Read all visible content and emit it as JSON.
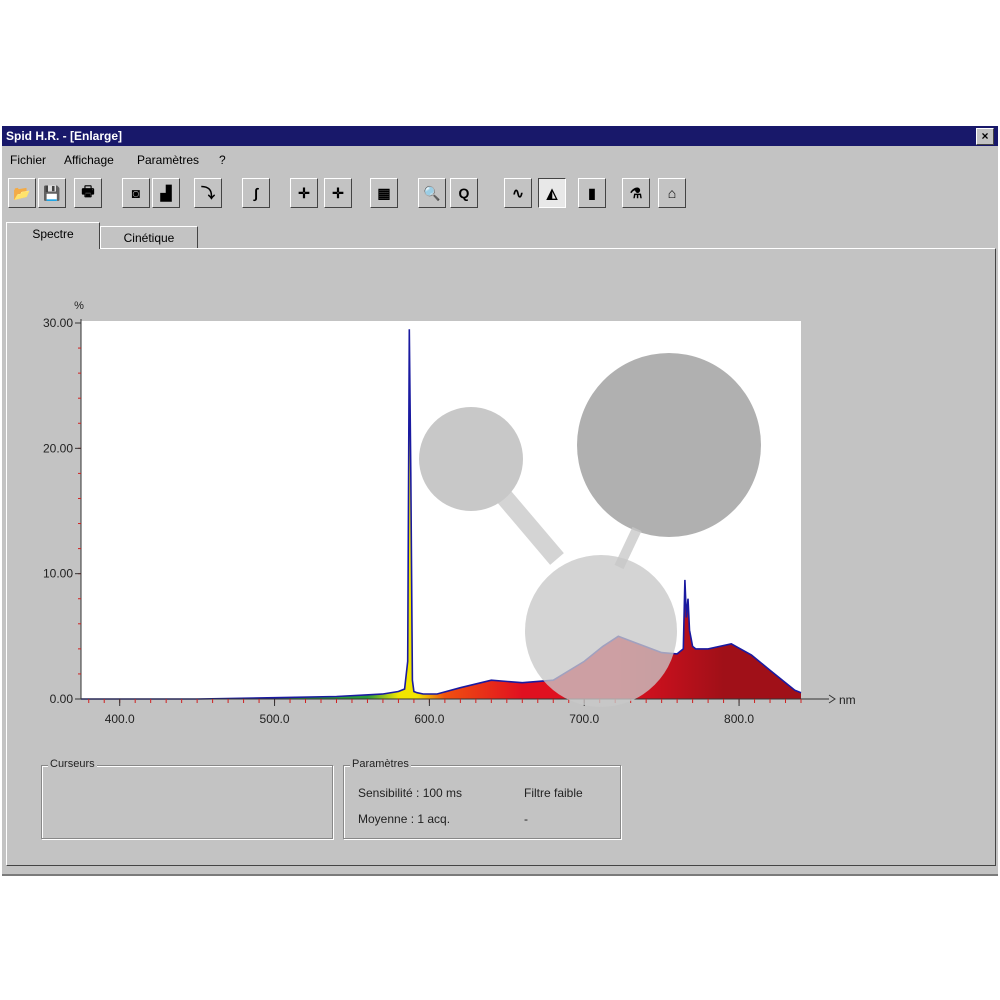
{
  "window": {
    "title": "Spid H.R. - [Enlarge]",
    "close_label": "×"
  },
  "menu": [
    {
      "label": "Fichier"
    },
    {
      "label": "Affichage"
    },
    {
      "label": "Paramètres"
    },
    {
      "label": "?"
    }
  ],
  "toolbar": [
    {
      "icon": "open-folder-icon",
      "glyph": "📂"
    },
    {
      "icon": "save-icon",
      "glyph": "💾"
    },
    {
      "icon": "print-icon",
      "glyph": "🖶"
    },
    {
      "icon": "camera-icon",
      "glyph": "◙"
    },
    {
      "icon": "spectrum-bars-icon",
      "glyph": "▟"
    },
    {
      "icon": "step-icon",
      "glyph": "⤵"
    },
    {
      "icon": "curve-fit-icon",
      "glyph": "∫"
    },
    {
      "icon": "cursor-cross-icon",
      "glyph": "✛"
    },
    {
      "icon": "cursor-move-icon",
      "glyph": "✛"
    },
    {
      "icon": "grid-icon",
      "glyph": "▦"
    },
    {
      "icon": "zoom-in-icon",
      "glyph": "🔍"
    },
    {
      "icon": "zoom-reset-icon",
      "glyph": "Q"
    },
    {
      "icon": "line-mode-icon",
      "glyph": "∿"
    },
    {
      "icon": "color-fill-icon",
      "glyph": "◭"
    },
    {
      "icon": "color-bars-icon",
      "glyph": "▮"
    },
    {
      "icon": "calibration-icon",
      "glyph": "⚗"
    },
    {
      "icon": "home-icon",
      "glyph": "⌂"
    }
  ],
  "tabs": [
    {
      "label": "Spectre",
      "active": true
    },
    {
      "label": "Cinétique",
      "active": false
    }
  ],
  "chart_data": {
    "type": "area",
    "title": "",
    "ylabel": "%",
    "xlabel": "nm",
    "xlim": [
      375,
      840
    ],
    "ylim": [
      0,
      30
    ],
    "x_ticks": [
      "400.0",
      "500.0",
      "600.0",
      "700.0",
      "800.0"
    ],
    "x_tick_values": [
      400,
      500,
      600,
      700,
      800
    ],
    "y_ticks": [
      "0.00",
      "10.00",
      "20.00",
      "30.00"
    ],
    "y_tick_values": [
      0,
      10,
      20,
      30
    ],
    "grid": false,
    "series": [
      {
        "x": [
          375,
          400,
          450,
          500,
          540,
          570,
          580,
          584,
          586,
          587,
          588,
          589,
          590,
          592,
          596,
          605,
          620,
          640,
          660,
          680,
          700,
          712,
          722,
          735,
          750,
          760,
          764,
          765,
          766,
          767,
          768,
          770,
          772,
          780,
          795,
          808,
          820,
          830,
          836,
          840
        ],
        "y": [
          0.0,
          0.0,
          0.0,
          0.1,
          0.2,
          0.4,
          0.6,
          0.8,
          3.0,
          29.5,
          18.0,
          1.5,
          0.6,
          0.5,
          0.4,
          0.4,
          0.9,
          1.5,
          1.3,
          1.5,
          3.0,
          4.2,
          5.0,
          4.4,
          3.7,
          3.6,
          4.0,
          9.5,
          6.5,
          8.0,
          5.5,
          4.2,
          4.0,
          4.0,
          4.4,
          3.5,
          2.3,
          1.3,
          0.7,
          0.5
        ]
      }
    ],
    "fill_colors": {
      "green": "#2a9a3a",
      "yellow": "#f2e600",
      "orange": "#f05010",
      "red": "#e01020",
      "dark_red": "#a01018"
    },
    "line_color": "#1a1aa0"
  },
  "curseurs": {
    "title": "Curseurs"
  },
  "parametres": {
    "title": "Paramètres",
    "sensibilite": "Sensibilité : 100 ms",
    "moyenne": "Moyenne : 1 acq.",
    "filtre": "Filtre faible",
    "dash": "-"
  }
}
